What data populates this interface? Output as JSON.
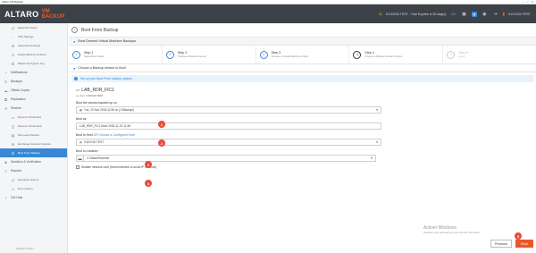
{
  "window": {
    "title": "Altaro VM Backup"
  },
  "brand": {
    "name": "ALTARO",
    "product": "VM BACKUP"
  },
  "topbar": {
    "trial_text": "5-DOCW-TEST - Trial Expires in 30 day(s)",
    "host_label": "5-DOCW-TEST"
  },
  "sidebar": {
    "items": [
      {
        "label": "Retention Policy",
        "level": 2,
        "icon": "retention-icon"
      },
      {
        "label": "VSS Settings",
        "level": 2,
        "icon": "vss-icon"
      },
      {
        "label": "Advanced Settings",
        "level": 2,
        "icon": "advanced-icon"
      },
      {
        "label": "Delete Backup Versions",
        "level": 2,
        "icon": "delete-icon"
      },
      {
        "label": "Master Encryption Key",
        "level": 2,
        "icon": "key-icon"
      },
      {
        "label": "Notifications",
        "level": 1,
        "icon": "bell-icon"
      },
      {
        "label": "Backups",
        "level": 1,
        "icon": "backup-icon"
      },
      {
        "label": "Offsite Copies",
        "level": 1,
        "icon": "cloud-icon"
      },
      {
        "label": "Replication",
        "level": 1,
        "icon": "replication-icon"
      },
      {
        "label": "Restore",
        "level": 1,
        "icon": "restore-icon"
      },
      {
        "label": "Restore Virtual Mac",
        "level": 2,
        "icon": "vm-icon"
      },
      {
        "label": "Restore Virtual Disk",
        "level": 2,
        "icon": "disk-icon"
      },
      {
        "label": "File Level Restore",
        "level": 2,
        "icon": "file-icon"
      },
      {
        "label": "Exchange Granular Restore",
        "level": 2,
        "icon": "mail-icon"
      },
      {
        "label": "Boot From Backup",
        "level": 2,
        "icon": "boot-icon",
        "active": true
      },
      {
        "label": "Sandbox & Verification",
        "level": 1,
        "icon": "sandbox-icon"
      },
      {
        "label": "Reports",
        "level": 1,
        "icon": "reports-icon"
      },
      {
        "label": "Operation History",
        "level": 2,
        "icon": "history-icon"
      },
      {
        "label": "Error History",
        "level": 2,
        "icon": "error-icon"
      },
      {
        "label": "Get Help",
        "level": 1,
        "icon": "help-icon"
      }
    ],
    "version": "Version: 8.0.0.7"
  },
  "page": {
    "title": "Boot From Backup",
    "section_title": "Boot Desired Virtual Machine Backups",
    "sub_title": "Choose a Backup version to Boot",
    "info_text": "Set up your Boot From backup options."
  },
  "steps": [
    {
      "num": "1",
      "title": "Step 1",
      "sub": "Select Boot Mode",
      "state": "done"
    },
    {
      "num": "2",
      "title": "Step 2",
      "sub": "Choose a Restore Source",
      "state": "done"
    },
    {
      "num": "3",
      "title": "Step 3",
      "sub": "Choose a Virtual Machine to Boot",
      "state": "done"
    },
    {
      "num": "4",
      "title": "Step 4",
      "sub": "Choose a Backup Version to Boot",
      "state": "current"
    },
    {
      "num": "5",
      "title": "Step 5",
      "sub": "Finish",
      "state": "pending"
    }
  ],
  "vm": {
    "name": "LAB_RDR_FIC1",
    "host_label": "on Host:",
    "host": "5-DOCW-TEST"
  },
  "form": {
    "version_label": "Boot the version backed up on",
    "version_value": "Tue, 20 Nov 2018 11:56 on (J:\\Backup\\)",
    "boot_as_label": "Boot as",
    "boot_as_value": "LAB_RDR_FIC1-Boot-2018-11-22-11-56",
    "host_label": "Boot to Host",
    "host_link": "OR Choose a Configured Host",
    "host_value": "5-DOCW-TEST",
    "location_label": "Boot to Location",
    "location_value": "C:\\AltaroRestored",
    "checkbox_label": "Disable network card (recommended to avoid IP conflicts)"
  },
  "markers": [
    "1",
    "2",
    "3",
    "4",
    "5"
  ],
  "watermark": {
    "title": "Activer Windows",
    "sub": "Accédez aux paramètres pour activer Windows."
  },
  "buttons": {
    "previous": "Previous",
    "boot": "Boot"
  }
}
